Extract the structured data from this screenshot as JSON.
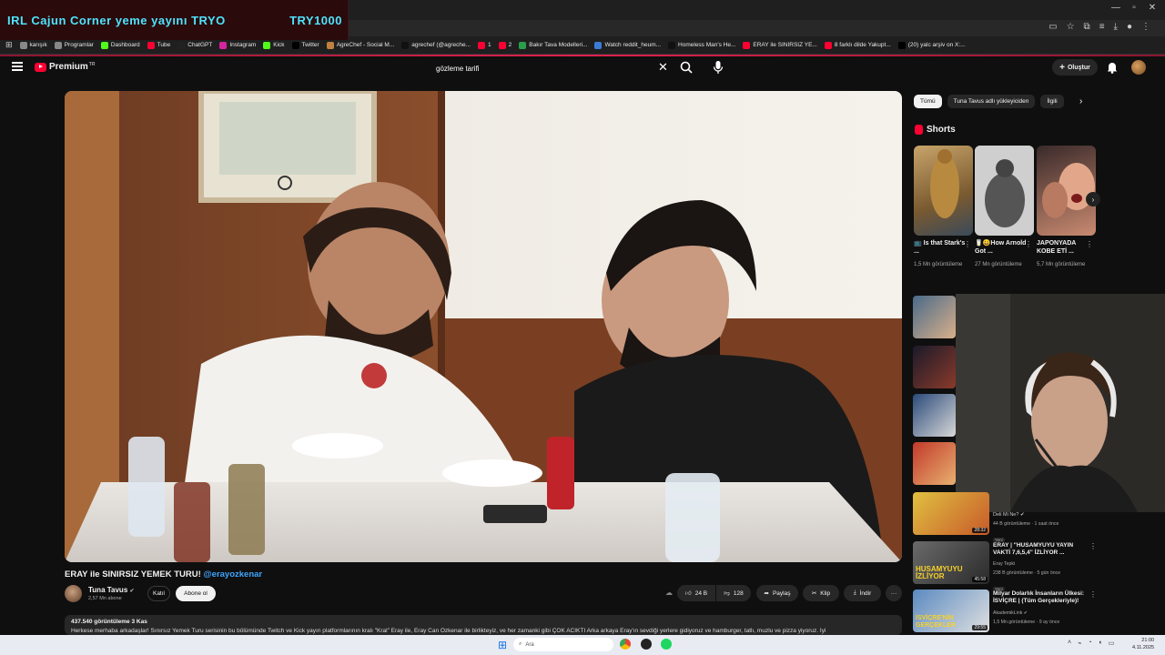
{
  "overlay": {
    "title": "IRL Cajun Corner yeme yayını  TRYO",
    "amount": "TRY1000"
  },
  "bookmarks": [
    {
      "label": "karışık",
      "color": "#888888"
    },
    {
      "label": "Programlar",
      "color": "#888888"
    },
    {
      "label": "Dashboard",
      "color": "#53fc18"
    },
    {
      "label": "Tube",
      "color": "#ff0033"
    },
    {
      "label": "ChatGPT",
      "color": "#222222"
    },
    {
      "label": "Instagram",
      "color": "#d6249f"
    },
    {
      "label": "Kick",
      "color": "#53fc18"
    },
    {
      "label": "Twitter",
      "color": "#000000"
    },
    {
      "label": "AgreChef - Social M...",
      "color": "#c08040"
    },
    {
      "label": "agrechef (@agreche...",
      "color": "#111111"
    },
    {
      "label": "1",
      "color": "#ff0033"
    },
    {
      "label": "2",
      "color": "#ff0033"
    },
    {
      "label": "Bakır Tava Modelleri...",
      "color": "#2a9d4a"
    },
    {
      "label": "Watch reddit_heum...",
      "color": "#3a7bd5"
    },
    {
      "label": "Homeless Man's He...",
      "color": "#111111"
    },
    {
      "label": "ERAY ile SINIRSIZ YE...",
      "color": "#ff0033"
    },
    {
      "label": "8 farklı dilde Yakupt...",
      "color": "#ff0033"
    },
    {
      "label": "(20) yalc arşiv on X:...",
      "color": "#000000"
    }
  ],
  "header": {
    "brand": "Premium",
    "brand_sup": "TR",
    "create_label": "Oluştur"
  },
  "search": {
    "value": "gözleme tarifi",
    "placeholder": "Ara"
  },
  "video": {
    "title": "ERAY ile SINIRSIZ YEMEK TURU!",
    "mention": "@erayozkenar",
    "channel": "Tuna Tavus",
    "subscribers": "2,57 Mn abone",
    "join_label": "Katıl",
    "subscribe_label": "Abone ol",
    "likes": "24 B",
    "dislikes": "128",
    "share_label": "Paylaş",
    "clip_label": "Klip",
    "download_label": "İndir",
    "stats": "437.540 görüntüleme  3 Kas",
    "description": "Herkese merhaba arkadaşlar! Sınırsız Yemek Turu serisinin bu bölümünde Twitch ve Kick yayın platformlarının kralı \"Kral\" Eray ile, Eray Can Özkenar ile birlikteyiz, ve her zamanki gibi ÇOK ACIKTI Arka arkaya Eray'ın sevdiği yerlere gidiyoruz ve hamburger, tatlı, muzlu ve pizza yiyoruz. İyi"
  },
  "chips": {
    "all": "Tümü",
    "uploader": "Tuna Tavus adlı yükleyiciden",
    "related": "İlgili"
  },
  "shorts": {
    "title": "Shorts",
    "items": [
      {
        "title": "📺 Is that Stark's ...",
        "views": "1,5 Mn görüntüleme"
      },
      {
        "title": "🥛😀How Arnold Got ...",
        "views": "27 Mn görüntüleme"
      },
      {
        "title": "JAPONYADA KOBE ETİ ...",
        "views": "5,7 Mn görüntüleme"
      }
    ]
  },
  "recommendations": [
    {
      "channel": "Deli Mi Ne?",
      "meta": "44 B görüntüleme · 1 saat önce",
      "badge": "Yeni",
      "duration": "28:32"
    },
    {
      "title": "ERAY | \"HUSAMYUYU YAYIN VAKTİ 7,6,5,4\" İZLİYOR ...",
      "channel": "Eray Tepki",
      "meta": "238 B görüntüleme · 5 gün önce",
      "badge": "Yeni",
      "duration": "45:58",
      "thumb_text": "HUSAMYUYU İZLİYOR"
    },
    {
      "title": "Milyar Dolarlık İnsanların Ülkesi: İSVİÇRE | (Tüm Gerçekleriyle)!",
      "channel": "AkademikLink",
      "meta": "1,5 Mn görüntüleme · 9 ay önce",
      "duration": "29:55",
      "thumb_text": "İSVİÇRE'NİN GERÇEKLER"
    }
  ],
  "taskbar": {
    "search_placeholder": "Ara",
    "time": "21:00",
    "date": "4.11.2025"
  },
  "colors": {
    "accent": "#ff0033",
    "link": "#3ea6ff",
    "overlay_text": "#4fe3ff",
    "background": "#0f0f0f"
  }
}
